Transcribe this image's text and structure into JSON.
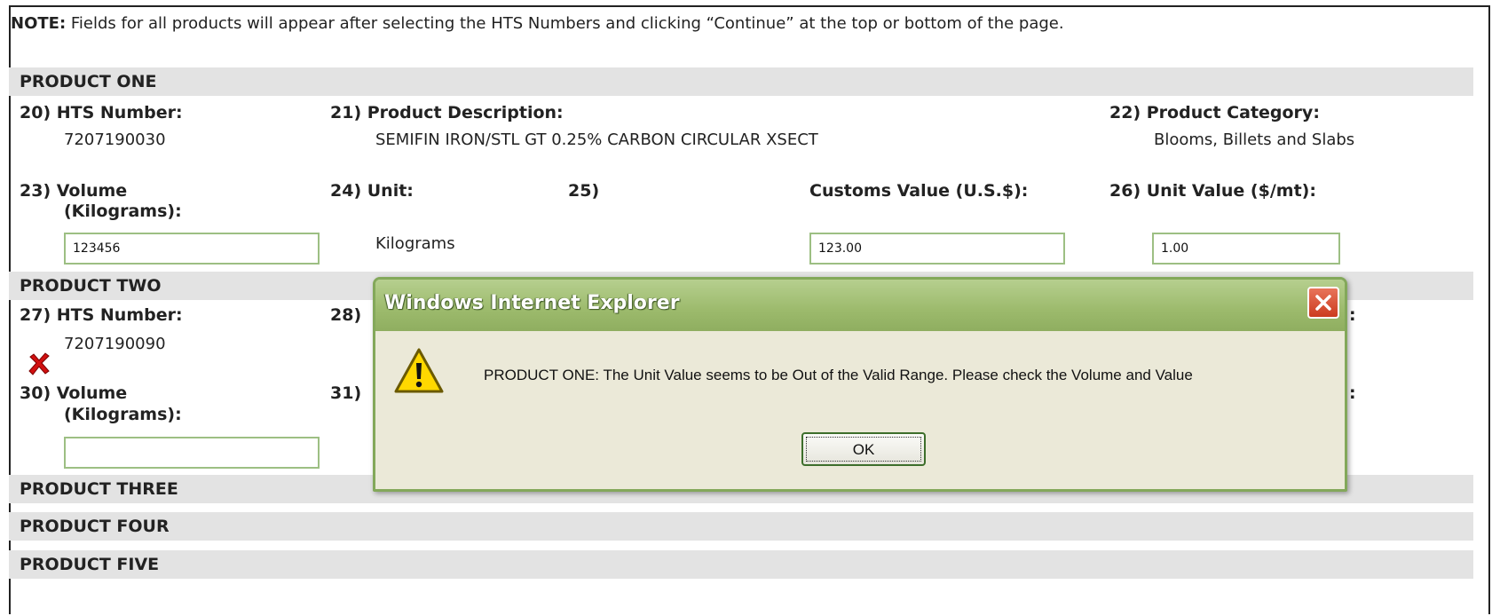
{
  "note": {
    "prefix": "NOTE:",
    "text": " Fields for all products will appear after selecting the HTS Numbers and clicking “Continue” at the top or bottom of the page."
  },
  "product_one": {
    "header": "PRODUCT ONE",
    "hts_label": "20) HTS Number:",
    "hts_value": "7207190030",
    "desc_label": "21) Product Description:",
    "desc_value": "SEMIFIN IRON/STL GT 0.25% CARBON CIRCULAR XSECT",
    "cat_label": "22) Product Category:",
    "cat_value": "Blooms, Billets and Slabs",
    "volume_label_1": "23) Volume",
    "volume_label_2": "(Kilograms):",
    "volume_value": "123456",
    "unit_label": "24) Unit:",
    "unit_value": "Kilograms",
    "num25_label": "25)",
    "customs_label": "Customs Value (U.S.$):",
    "customs_value": "123.00",
    "unit_value_label": "26) Unit Value ($/mt):",
    "unit_value_value": "1.00"
  },
  "product_two": {
    "header": "PRODUCT TWO",
    "hts_label": "27) HTS Number:",
    "hts_value": "7207190090",
    "num28_label": "28)",
    "volume_label_1": "30) Volume",
    "volume_label_2": "(Kilograms):",
    "volume_value": "",
    "num31_label": "31)",
    "colon_a": ":",
    "colon_b": ":",
    "status_icon": "x-mark-icon",
    "status_color": "#d11010"
  },
  "product_three": {
    "header": "PRODUCT THREE"
  },
  "product_four": {
    "header": "PRODUCT FOUR"
  },
  "product_five": {
    "header": "PRODUCT FIVE"
  },
  "dialog": {
    "title": "Windows Internet Explorer",
    "message": "PRODUCT ONE: The Unit Value seems to be Out of the Valid Range. Please check the Volume and Value",
    "ok_label": "OK",
    "icon": "warning-icon",
    "close_icon": "close-icon"
  }
}
